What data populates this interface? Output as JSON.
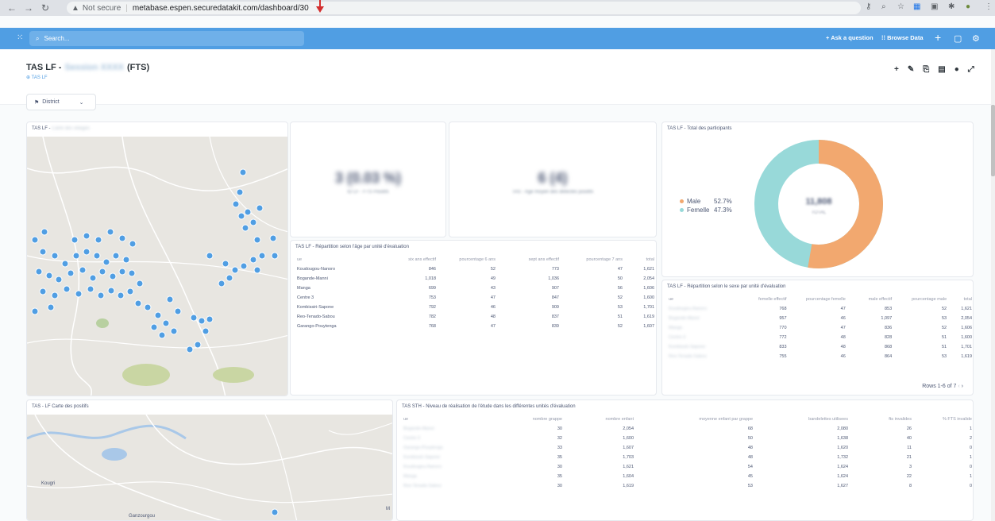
{
  "browser": {
    "security_label": "Not secure",
    "url": "metabase.espen.securedatakit.com/dashboard/30"
  },
  "nav": {
    "search_placeholder": "Search...",
    "ask_question": "Ask a question",
    "browse_data": "Browse Data"
  },
  "dashboard": {
    "title_prefix": "TAS LF -",
    "title_blurred": "Session XXXX",
    "title_suffix": "(FTS)",
    "collection": "TAS LF",
    "filter_label": "District"
  },
  "cards": {
    "map_villages_title": "TAS LF -",
    "map_villages_title_blurred": "Carte des villages",
    "scalar1_value": "3 (0.03 %)",
    "scalar1_label": "ID LF - FTS Positifs",
    "scalar2_value": "6 (4)",
    "scalar2_label": "TAS - Age moyen des détectés positifs",
    "total_title": "TAS LF - Total des participants",
    "age_table_title": "TAS LF - Répartition selon l'âge par unité d'évaluation",
    "sex_table_title": "TAS LF - Répartition selon le sexe par unité d'évaluation",
    "map_positives_title": "TAS - LF Carte des positifs",
    "sth_title": "TAS STH - Niveau de réalisation de l'étude dans les différentes unités d'évaluation",
    "rows_footer": "Rows 1-6 of 7"
  },
  "donut": {
    "center_value": "11,808",
    "center_label": "TOTAL",
    "legend": [
      {
        "label": "Male",
        "pct": "52.7%",
        "color": "#f2a86f"
      },
      {
        "label": "Femelle",
        "pct": "47.3%",
        "color": "#98d9d9"
      }
    ]
  },
  "age_table": {
    "headers": [
      "ue",
      "six ans effectif",
      "pourcentage 6 ans",
      "sept ans effectif",
      "pourcentage 7 ans",
      "total"
    ],
    "rows": [
      [
        "Koudougou-Nanoro",
        "846",
        "52",
        "773",
        "47",
        "1,621"
      ],
      [
        "Bogande-Manni",
        "1,018",
        "49",
        "1,036",
        "50",
        "2,054"
      ],
      [
        "Manga",
        "699",
        "43",
        "907",
        "56",
        "1,606"
      ],
      [
        "Centre 3",
        "753",
        "47",
        "847",
        "52",
        "1,600"
      ],
      [
        "Kombissiri-Sapone",
        "792",
        "46",
        "909",
        "53",
        "1,701"
      ],
      [
        "Reo-Tenado-Sabou",
        "782",
        "48",
        "837",
        "51",
        "1,619"
      ],
      [
        "Garango-Pouytenga",
        "768",
        "47",
        "839",
        "52",
        "1,607"
      ]
    ]
  },
  "sex_table": {
    "headers": [
      "ue",
      "femelle effectif",
      "pourcentage femelle",
      "male effectif",
      "pourcentage male",
      "total"
    ],
    "rows": [
      [
        "Koudougou-Nanoro",
        "768",
        "47",
        "853",
        "52",
        "1,621"
      ],
      [
        "Bogande-Manni",
        "957",
        "46",
        "1,097",
        "53",
        "2,054"
      ],
      [
        "Manga",
        "770",
        "47",
        "836",
        "52",
        "1,606"
      ],
      [
        "Centre 3",
        "772",
        "48",
        "828",
        "51",
        "1,600"
      ],
      [
        "Kombissiri-Sapone",
        "833",
        "48",
        "868",
        "51",
        "1,701"
      ],
      [
        "Reo-Tenado-Sabou",
        "755",
        "46",
        "864",
        "53",
        "1,619"
      ]
    ]
  },
  "sth_table": {
    "headers": [
      "ue",
      "nombre grappe",
      "nombre enfant",
      "moyenne enfant par grappe",
      "bandelettes utilisees",
      "fts invalides",
      "% FTS invalide"
    ],
    "rows": [
      [
        "Bogande-Manni",
        "30",
        "2,054",
        "68",
        "2,080",
        "26",
        "1"
      ],
      [
        "Centre 3",
        "32",
        "1,600",
        "50",
        "1,638",
        "40",
        "2"
      ],
      [
        "Garango-Pouytenga",
        "33",
        "1,607",
        "48",
        "1,620",
        "11",
        "0"
      ],
      [
        "Kombissiri-Sapone",
        "35",
        "1,703",
        "48",
        "1,732",
        "21",
        "1"
      ],
      [
        "Koudougou-Nanoro",
        "30",
        "1,621",
        "54",
        "1,624",
        "3",
        "0"
      ],
      [
        "Manga",
        "35",
        "1,604",
        "45",
        "1,624",
        "22",
        "1"
      ],
      [
        "Reo-Tenado-Sabou",
        "30",
        "1,619",
        "53",
        "1,627",
        "8",
        "0"
      ]
    ]
  },
  "map_labels": {
    "town1": "Kougri",
    "town2": "Ganzourgou",
    "corner": "M"
  }
}
